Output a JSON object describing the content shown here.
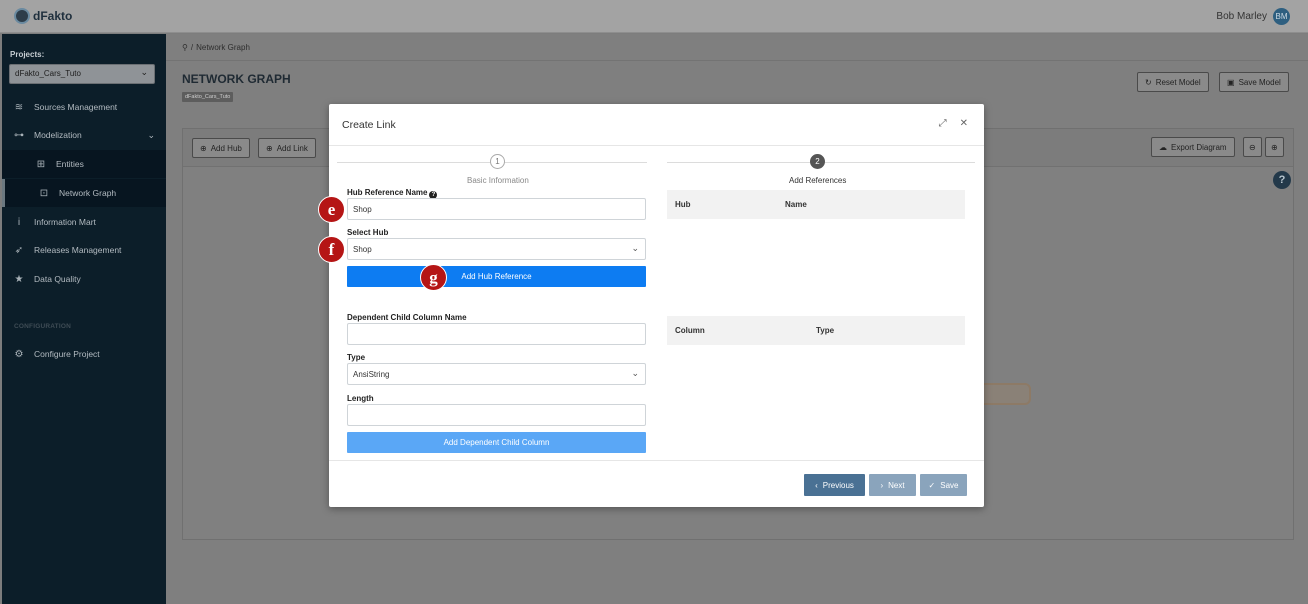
{
  "app": {
    "logo_text": "dFakto"
  },
  "user": {
    "name": "Bob Marley",
    "initials": "BM"
  },
  "sidebar": {
    "projects_label": "Projects:",
    "project_selected": "dFakto_Cars_Tuto",
    "items": [
      {
        "label": "Sources Management",
        "icon": "layers-icon"
      },
      {
        "label": "Modelization",
        "icon": "sitemap-icon"
      },
      {
        "label": "Entities",
        "icon": "entities-icon"
      },
      {
        "label": "Network Graph",
        "icon": "binoculars-icon"
      },
      {
        "label": "Information Mart",
        "icon": "info-icon"
      },
      {
        "label": "Releases Management",
        "icon": "rocket-icon"
      },
      {
        "label": "Data Quality",
        "icon": "star-icon"
      },
      {
        "label": "Configure Project",
        "icon": "gear-icon"
      }
    ],
    "config_label": "CONFIGURATION"
  },
  "main": {
    "breadcrumb": "Network Graph",
    "title": "NETWORK GRAPH",
    "badge": "dFakto_Cars_Tuto",
    "buttons": {
      "reset_model": "Reset Model",
      "save_model": "Save Model",
      "add_hub": "Add Hub",
      "add_link": "Add Link",
      "export_diagram": "Export Diagram"
    },
    "help": "?"
  },
  "modal": {
    "title": "Create Link",
    "steps": [
      {
        "number": "1",
        "label": "Basic Information"
      },
      {
        "number": "2",
        "label": "Add References"
      }
    ],
    "hub_reference_name": {
      "label": "Hub Reference Name",
      "value": "Shop"
    },
    "select_hub": {
      "label": "Select Hub",
      "value": "Shop"
    },
    "add_hub_reference": "Add Hub Reference",
    "dependent_child_column_name": {
      "label": "Dependent Child Column Name",
      "value": ""
    },
    "type": {
      "label": "Type",
      "value": "AnsiString"
    },
    "length": {
      "label": "Length",
      "value": ""
    },
    "add_dependent_child_column": "Add Dependent Child Column",
    "hub_table": {
      "col1": "Hub",
      "col2": "Name"
    },
    "column_table": {
      "col1": "Column",
      "col2": "Type"
    },
    "footer": {
      "previous": "Previous",
      "next": "Next",
      "save": "Save"
    }
  },
  "markers": {
    "e": "e",
    "f": "f",
    "g": "g"
  },
  "colors": {
    "primary": "#0d7cf2",
    "primary_light": "#5aa7f6",
    "slate": "#4a7194",
    "slate_light": "#8aa4bc"
  }
}
